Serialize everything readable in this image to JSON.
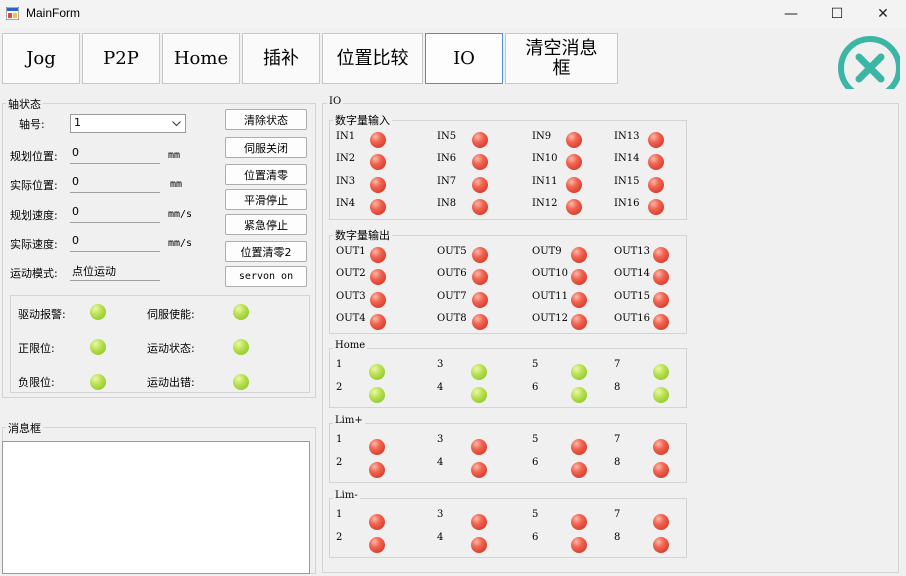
{
  "window": {
    "title": "MainForm",
    "min_glyph": "—",
    "max_glyph": "☐",
    "close_glyph": "✕"
  },
  "tabs": [
    "Jog",
    "P2P",
    "Home",
    "插补",
    "位置比较",
    "IO",
    "清空消息框"
  ],
  "active_tab": "IO",
  "axis_panel": {
    "title": "轴状态",
    "axis_label": "轴号:",
    "axis_value": "1",
    "fields": [
      {
        "label": "规划位置:",
        "value": "0",
        "unit": "mm"
      },
      {
        "label": "实际位置:",
        "value": "0",
        "unit": "mm"
      },
      {
        "label": "规划速度:",
        "value": "0",
        "unit": "mm/s"
      },
      {
        "label": "实际速度:",
        "value": "0",
        "unit": "mm/s"
      }
    ],
    "mode_label": "运动模式:",
    "mode_value": "点位运动",
    "buttons": [
      "清除状态",
      "伺服关闭",
      "位置清零",
      "平滑停止",
      "紧急停止",
      "位置清零2",
      "servon on"
    ],
    "status": [
      {
        "label": "驱动报警:",
        "state": "green"
      },
      {
        "label": "伺服使能:",
        "state": "green"
      },
      {
        "label": "正限位:",
        "state": "green"
      },
      {
        "label": "运动状态:",
        "state": "green"
      },
      {
        "label": "负限位:",
        "state": "green"
      },
      {
        "label": "运动出错:",
        "state": "green"
      }
    ]
  },
  "message_panel": {
    "title": "消息框",
    "content": ""
  },
  "io_panel": {
    "title": "IO",
    "groups": [
      {
        "title": "数字量输入",
        "items": [
          "IN1",
          "IN5",
          "IN9",
          "IN13",
          "IN2",
          "IN6",
          "IN10",
          "IN14",
          "IN3",
          "IN7",
          "IN11",
          "IN15",
          "IN4",
          "IN8",
          "IN12",
          "IN16"
        ],
        "states": [
          "red",
          "red",
          "red",
          "red",
          "red",
          "red",
          "red",
          "red",
          "red",
          "red",
          "red",
          "red",
          "red",
          "red",
          "red",
          "red"
        ]
      },
      {
        "title": "数字量输出",
        "items": [
          "OUT1",
          "OUT5",
          "OUT9",
          "OUT13",
          "OUT2",
          "OUT6",
          "OUT10",
          "OUT14",
          "OUT3",
          "OUT7",
          "OUT11",
          "OUT15",
          "OUT4",
          "OUT8",
          "OUT12",
          "OUT16"
        ],
        "states": [
          "red",
          "red",
          "red",
          "red",
          "red",
          "red",
          "red",
          "red",
          "red",
          "red",
          "red",
          "red",
          "red",
          "red",
          "red",
          "red"
        ]
      },
      {
        "title": "Home",
        "items": [
          "1",
          "3",
          "5",
          "7",
          "2",
          "4",
          "6",
          "8"
        ],
        "states": [
          "green",
          "green",
          "green",
          "green",
          "green",
          "green",
          "green",
          "green"
        ]
      },
      {
        "title": "Lim+",
        "items": [
          "1",
          "3",
          "5",
          "7",
          "2",
          "4",
          "6",
          "8"
        ],
        "states": [
          "red",
          "red",
          "red",
          "red",
          "red",
          "red",
          "red",
          "red"
        ]
      },
      {
        "title": "Lim-",
        "items": [
          "1",
          "3",
          "5",
          "7",
          "2",
          "4",
          "6",
          "8"
        ],
        "states": [
          "red",
          "red",
          "red",
          "red",
          "red",
          "red",
          "red",
          "red"
        ]
      }
    ]
  },
  "colors": {
    "led_red": "#e54b3a",
    "led_green": "#a5d63a",
    "accent_teal": "#3cb6a4",
    "active_border": "#4a8fd8"
  }
}
